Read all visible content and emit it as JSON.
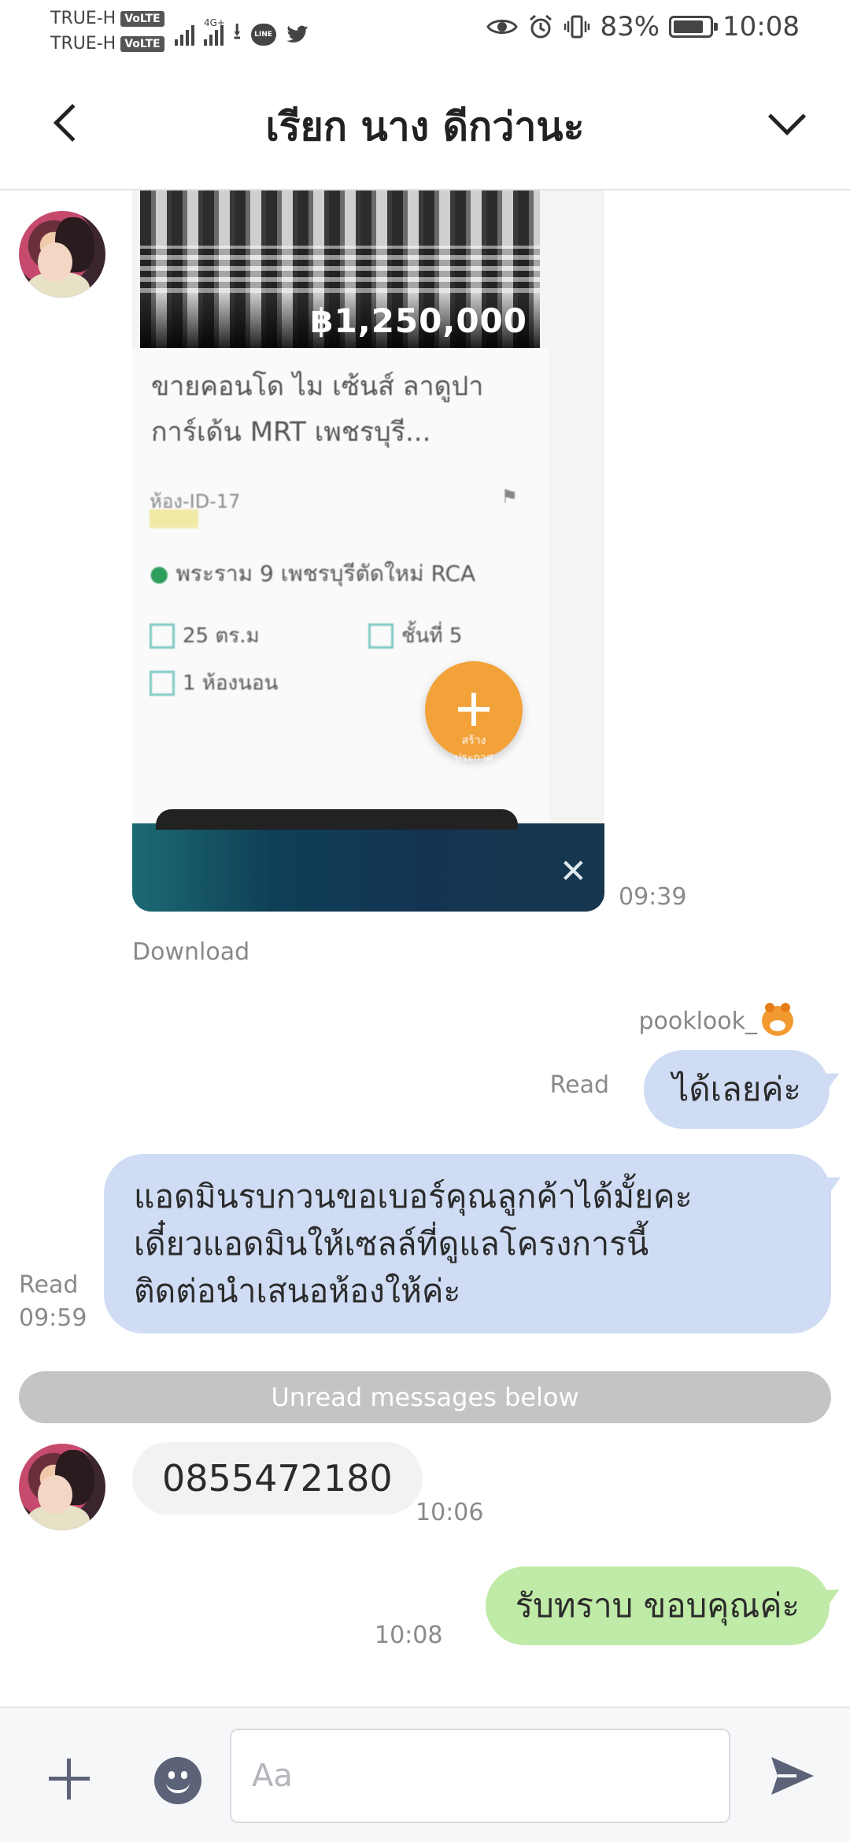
{
  "status_bar": {
    "carrier1": "TRUE-H",
    "carrier2": "TRUE-H",
    "volte": "VoLTE",
    "network": "4G+",
    "line_badge": "LINE",
    "battery": "83%",
    "battery_level": 0.83,
    "time": "10:08"
  },
  "header": {
    "title": "เรียก นาง ดีกว่านะ"
  },
  "messages": {
    "image": {
      "price": "฿1,250,000",
      "title": "ขายคอนโด ไม เซ้นส์ ลาดูปา การ์เด้น MRT เพชรบุรี...",
      "meta": "ห้อง-ID-17",
      "location": "พระราม 9 เพชรบุรีตัดใหม่ RCA",
      "feature1": "25 ตร.ม",
      "feature2": "ชั้นที่ 5",
      "feature3": "1 ห้องนอน",
      "fab_label": "สร้าง ประกาศ",
      "time": "09:39",
      "download": "Download"
    },
    "sender_name": "pooklook_",
    "out1": {
      "text": "ได้เลยค่ะ",
      "read": "Read"
    },
    "out2": {
      "text": "แอดมินรบกวนขอเบอร์คุณลูกค้าได้มั้ยคะ\nเดี๋ยวแอดมินให้เซลล์ที่ดูแลโครงการนี้\nติดต่อนำเสนอห้องให้ค่ะ",
      "read": "Read",
      "time": "09:59"
    },
    "unread_divider": "Unread messages below",
    "in1": {
      "text": "0855472180",
      "time": "10:06"
    },
    "out3": {
      "text": "รับทราบ ขอบคุณค่ะ",
      "time": "10:08"
    }
  },
  "input": {
    "placeholder": "Aa"
  },
  "colors": {
    "outgoing_bubble": "#cfdcf4",
    "incoming_bubble": "#f1f2f4",
    "green_bubble": "#c0eaa7",
    "unread_bar": "#c4c4c4",
    "icon_gray": "#5c6378"
  }
}
